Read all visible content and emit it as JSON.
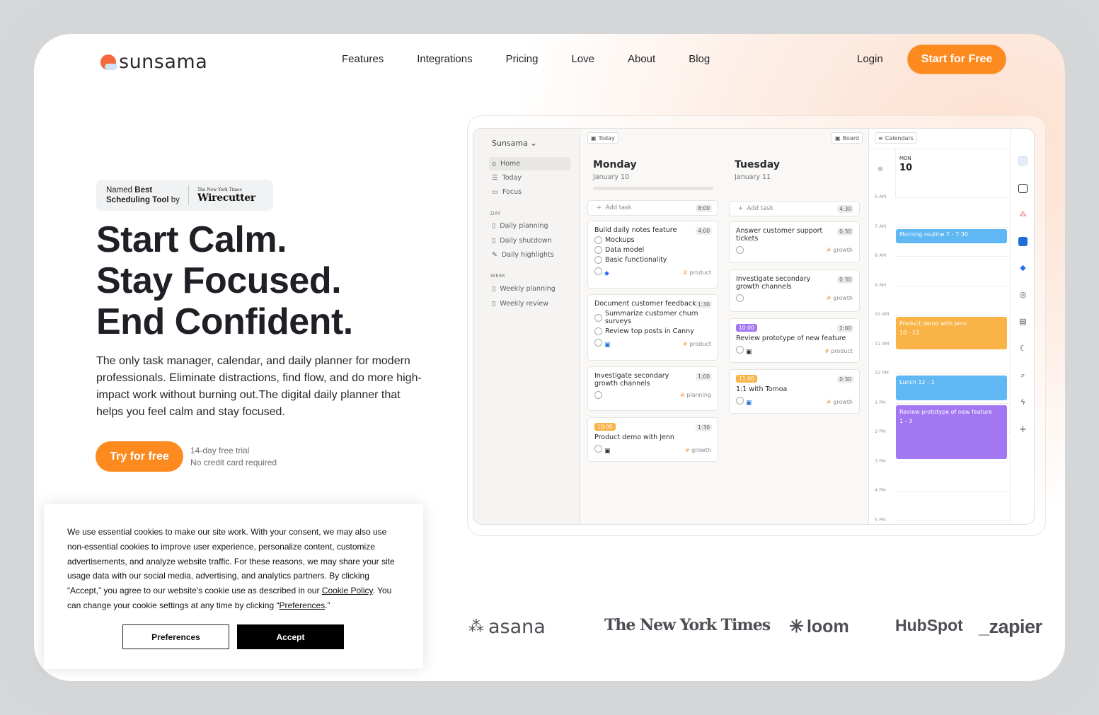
{
  "brand": {
    "name": "sunsama"
  },
  "nav": {
    "items": [
      "Features",
      "Integrations",
      "Pricing",
      "Love",
      "About",
      "Blog"
    ],
    "login": "Login",
    "cta": "Start for Free"
  },
  "badge": {
    "line1_pre": "Named ",
    "line1_bold": "Best",
    "line2_bold": "Scheduling Tool",
    "line2_post": " by",
    "nyt": "The New York Times",
    "wirecutter": "Wirecutter"
  },
  "hero": {
    "line1": "Start Calm.",
    "line2": "Stay Focused.",
    "line3": "End Confident.",
    "subtitle": "The only task manager, calendar, and daily planner for modern professionals. Eliminate distractions, find flow, and do more high-impact work without burning out.The digital daily planner that helps you feel calm and stay focused.",
    "cta": "Try for free",
    "trial1": "14-day free trial",
    "trial2": "No credit card required"
  },
  "app": {
    "workspace": "Sunsama",
    "nav": [
      "Home",
      "Today",
      "Focus"
    ],
    "day_section": "DAY",
    "day_items": [
      "Daily planning",
      "Daily shutdown",
      "Daily highlights"
    ],
    "week_section": "WEEK",
    "week_items": [
      "Weekly planning",
      "Weekly review"
    ],
    "today_btn": "Today",
    "board_btn": "Board",
    "calendars_btn": "Calendars",
    "add_task": "Add task",
    "monday": {
      "name": "Monday",
      "date": "January 10",
      "total": "8:00"
    },
    "tuesday": {
      "name": "Tuesday",
      "date": "January 11",
      "total": "4:30"
    },
    "mon_cards": [
      {
        "title": "Build daily notes feature",
        "dur": "4:00",
        "subs": [
          "Mockups",
          "Data model",
          "Basic functionality"
        ],
        "tag": "product"
      },
      {
        "title": "Document customer feedback",
        "dur": "1:30",
        "subs": [
          "Summarize customer churn surveys",
          "Review top posts in Canny"
        ],
        "tag": "product"
      },
      {
        "title": "Investigate secondary growth channels",
        "dur": "1:00",
        "tag": "planning"
      },
      {
        "time": "10:00",
        "title": "Product demo with Jenn",
        "dur": "1:30",
        "tag": "growth"
      }
    ],
    "tue_cards": [
      {
        "title": "Answer customer support tickets",
        "dur": "0:30",
        "tag": "growth"
      },
      {
        "title": "Investigate secondary growth channels",
        "dur": "0:30",
        "tag": "growth"
      },
      {
        "time": "10:00",
        "title": "Review prototype of new feature",
        "dur": "2:00",
        "tag": "product"
      },
      {
        "time": "11:00",
        "title": "1:1 with Tomoa",
        "dur": "0:30",
        "tag": "growth"
      }
    ],
    "cal": {
      "dow": "MON",
      "day": "10",
      "hours": [
        "6 AM",
        "7 AM",
        "8 AM",
        "9 AM",
        "10 AM",
        "11 AM",
        "12 PM",
        "1 PM",
        "2 PM",
        "3 PM",
        "4 PM",
        "5 PM"
      ],
      "events": [
        {
          "title": "Morning routine",
          "time": "7 - 7:30",
          "color": "#5fb7f3"
        },
        {
          "title": "Product demo with Jenn",
          "time": "10 - 11",
          "color": "#f9b346"
        },
        {
          "title": "Lunch",
          "time": "12 - 1",
          "color": "#5fb7f3"
        },
        {
          "title": "Review prototype of new feature",
          "time": "1 - 3",
          "color": "#a377f2"
        }
      ]
    }
  },
  "logos": [
    "asana",
    "The New York Times",
    "loom",
    "HubSpot",
    "_zapier"
  ],
  "cookie": {
    "text_pre": "We use essential cookies to make our site work. With your consent, we may also use non-essential cookies to improve user experience, personalize content, customize advertisements, and analyze website traffic. For these reasons, we may share your site usage data with our social media, advertising, and analytics partners. By clicking “Accept,” you agree to our website's cookie use as described in our ",
    "policy_link": "Cookie Policy",
    "text_mid": ". You can change your cookie settings at any time by clicking “",
    "prefs_link": "Preferences",
    "text_post": ".”",
    "preferences_btn": "Preferences",
    "accept_btn": "Accept"
  },
  "colors": {
    "accent": "#fc8a1f",
    "purple": "#a377f2",
    "blue": "#5fb7f3",
    "orange": "#f9b346"
  }
}
